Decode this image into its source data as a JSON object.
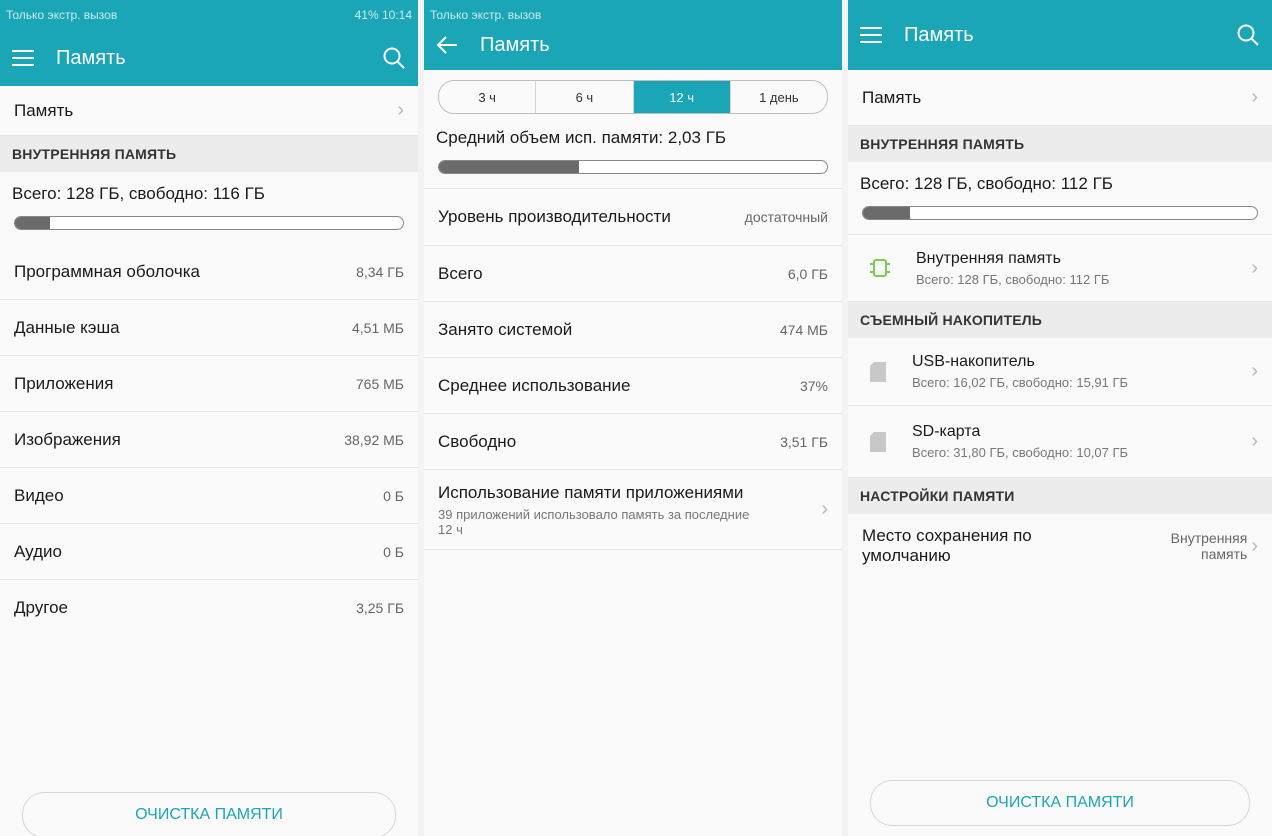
{
  "colors": {
    "accent": "#1aa6b7",
    "bar_fill": "#6b6b6b"
  },
  "panel1": {
    "status_left": "Только экстр. вызов",
    "status_right": "41% 10:14",
    "title": "Память",
    "memory_row": "Память",
    "section_internal": "ВНУТРЕННЯЯ ПАМЯТЬ",
    "total": "Всего: 128 ГБ, свободно: 116 ГБ",
    "used_fraction": 0.09,
    "items": [
      {
        "label": "Программная оболочка",
        "value": "8,34 ГБ"
      },
      {
        "label": "Данные кэша",
        "value": "4,51 МБ"
      },
      {
        "label": "Приложения",
        "value": "765 МБ"
      },
      {
        "label": "Изображения",
        "value": "38,92 МБ"
      },
      {
        "label": "Видео",
        "value": "0 Б"
      },
      {
        "label": "Аудио",
        "value": "0 Б"
      },
      {
        "label": "Другое",
        "value": "3,25 ГБ"
      }
    ],
    "clean_button": "ОЧИСТКА ПАМЯТИ"
  },
  "panel2": {
    "status_left": "Только экстр. вызов",
    "title": "Память",
    "tabs": [
      "3 ч",
      "6 ч",
      "12 ч",
      "1 день"
    ],
    "active_tab": 2,
    "avg_label": "Средний объем исп. памяти: 2,03 ГБ",
    "used_fraction": 0.36,
    "items": [
      {
        "label": "Уровень производительности",
        "value": "достаточный"
      },
      {
        "label": "Всего",
        "value": "6,0 ГБ"
      },
      {
        "label": "Занято системой",
        "value": "474 МБ"
      },
      {
        "label": "Среднее использование",
        "value": "37%"
      },
      {
        "label": "Свободно",
        "value": "3,51 ГБ"
      }
    ],
    "apps_usage_title": "Использование памяти приложениями",
    "apps_usage_sub": "39 приложений использовало память за последние 12 ч"
  },
  "panel3": {
    "title": "Память",
    "memory_row": "Память",
    "section_internal": "ВНУТРЕННЯЯ ПАМЯТЬ",
    "total": "Всего: 128 ГБ, свободно: 112 ГБ",
    "used_fraction": 0.12,
    "internal_name": "Внутренняя память",
    "internal_sub": "Всего: 128 ГБ, свободно: 112 ГБ",
    "section_removable": "СЪЕМНЫЙ НАКОПИТЕЛЬ",
    "usb_name": "USB-накопитель",
    "usb_sub": "Всего: 16,02 ГБ, свободно: 15,91 ГБ",
    "sd_name": "SD-карта",
    "sd_sub": "Всего: 31,80 ГБ, свободно: 10,07 ГБ",
    "section_settings": "НАСТРОЙКИ ПАМЯТИ",
    "default_location_label": "Место сохранения по умолчанию",
    "default_location_value": "Внутренняя память",
    "clean_button": "ОЧИСТКА ПАМЯТИ"
  }
}
